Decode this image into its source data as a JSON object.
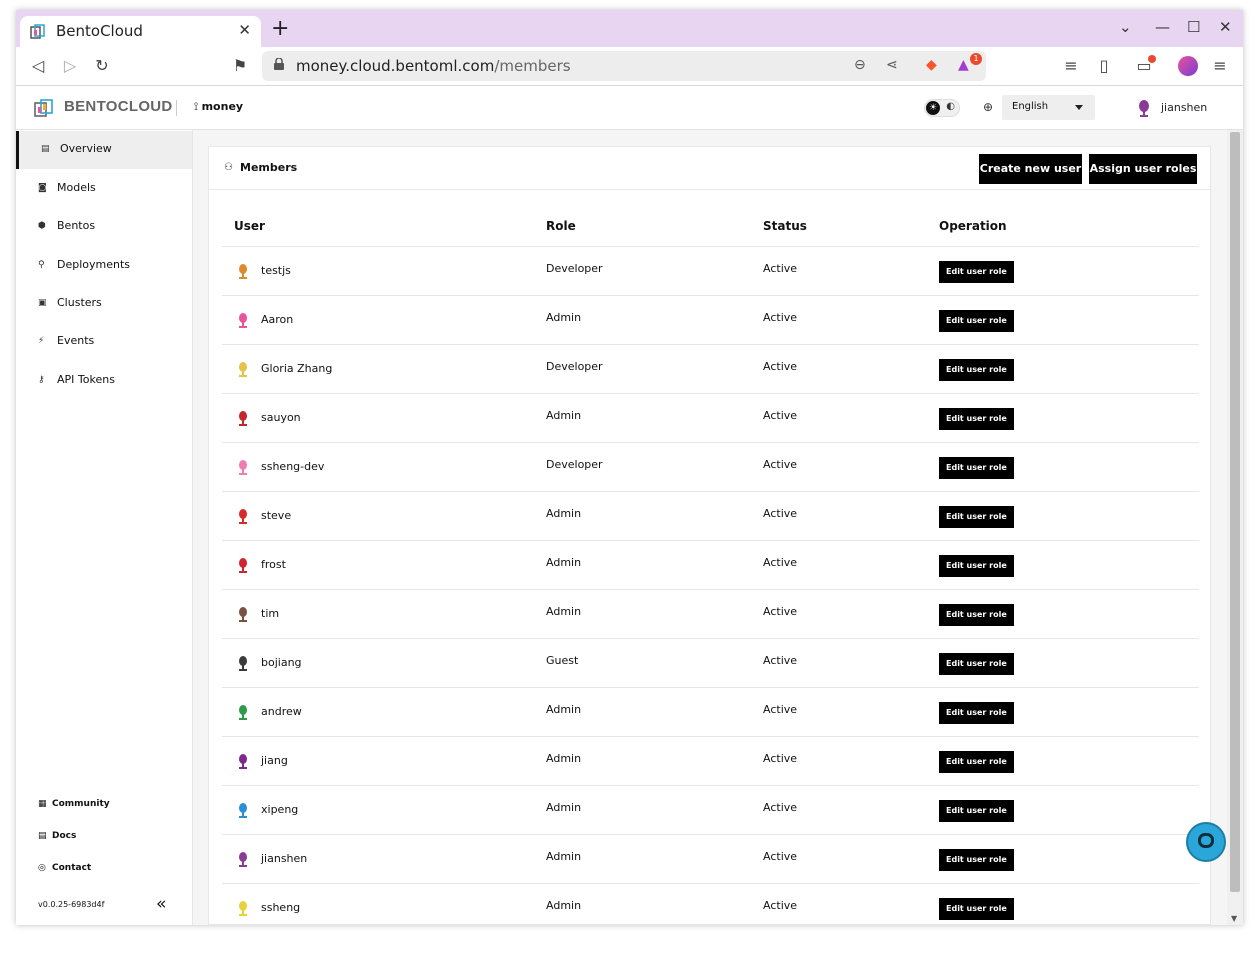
{
  "browser": {
    "tab_title": "BentoCloud",
    "url_host": "money.cloud.bentoml.com",
    "url_path": "/members",
    "shields_badge": "1"
  },
  "header": {
    "brand": "BENTOCLOUD",
    "org": "money",
    "language": "English",
    "username": "jianshen"
  },
  "sidebar": {
    "items": [
      {
        "label": "Overview",
        "icon": "overview-icon"
      },
      {
        "label": "Models",
        "icon": "models-icon"
      },
      {
        "label": "Bentos",
        "icon": "bentos-icon"
      },
      {
        "label": "Deployments",
        "icon": "deployments-icon"
      },
      {
        "label": "Clusters",
        "icon": "clusters-icon"
      },
      {
        "label": "Events",
        "icon": "events-icon"
      },
      {
        "label": "API Tokens",
        "icon": "api-tokens-icon"
      }
    ],
    "footer": [
      {
        "label": "Community",
        "icon": "community-icon"
      },
      {
        "label": "Docs",
        "icon": "docs-icon"
      },
      {
        "label": "Contact",
        "icon": "contact-icon"
      }
    ],
    "version": "v0.0.25-6983d4f"
  },
  "members": {
    "title": "Members",
    "create_button": "Create new user",
    "assign_button": "Assign user roles",
    "columns": [
      "User",
      "Role",
      "Status",
      "Operation"
    ],
    "edit_label": "Edit user role",
    "rows": [
      {
        "user": "testjs",
        "role": "Developer",
        "status": "Active",
        "color": "#e08a2e"
      },
      {
        "user": "Aaron",
        "role": "Admin",
        "status": "Active",
        "color": "#e9549a"
      },
      {
        "user": "Gloria Zhang",
        "role": "Developer",
        "status": "Active",
        "color": "#e6c24a"
      },
      {
        "user": "sauyon",
        "role": "Admin",
        "status": "Active",
        "color": "#c1272d"
      },
      {
        "user": "ssheng-dev",
        "role": "Developer",
        "status": "Active",
        "color": "#f07cb0"
      },
      {
        "user": "steve",
        "role": "Admin",
        "status": "Active",
        "color": "#d52b2b"
      },
      {
        "user": "frost",
        "role": "Admin",
        "status": "Active",
        "color": "#d02430"
      },
      {
        "user": "tim",
        "role": "Admin",
        "status": "Active",
        "color": "#7a5240"
      },
      {
        "user": "bojiang",
        "role": "Guest",
        "status": "Active",
        "color": "#3b3b3b"
      },
      {
        "user": "andrew",
        "role": "Admin",
        "status": "Active",
        "color": "#2e9a4a"
      },
      {
        "user": "jiang",
        "role": "Admin",
        "status": "Active",
        "color": "#7b2a8a"
      },
      {
        "user": "xipeng",
        "role": "Admin",
        "status": "Active",
        "color": "#2b8fd8"
      },
      {
        "user": "jianshen",
        "role": "Admin",
        "status": "Active",
        "color": "#8a3b95"
      },
      {
        "user": "ssheng",
        "role": "Admin",
        "status": "Active",
        "color": "#e8d23a"
      }
    ]
  }
}
